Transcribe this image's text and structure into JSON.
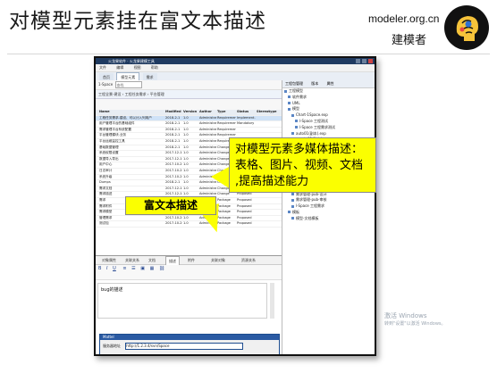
{
  "slide": {
    "title": "对模型元素挂在富文本描述",
    "site": "modeler.org.cn",
    "brand": "建模者"
  },
  "callout": {
    "lines": [
      "对模型元素多媒体描述：",
      "表格、图片、视频、文档",
      ",提高描述能力"
    ]
  },
  "label": {
    "text": "富文本描述"
  },
  "app": {
    "title_bar": "火龙果软件 · 火龙果建模工具",
    "menu": [
      "文件",
      "编辑",
      "视图",
      "帮助"
    ],
    "tabs": [
      "首页",
      "模型元素",
      "需求"
    ],
    "toolbar": {
      "package": "1-Space",
      "search_placeholder": "查找"
    },
    "path": "工程全景-建设 › 工程任务需求 › 平台管理",
    "grid_headers": [
      "Name",
      "Modified",
      "Version",
      "Author",
      "Type",
      "Status",
      "Stereotype"
    ],
    "grid_rows": [
      [
        "工程任务需求-建设、可以计入列用户",
        "2018-2-1",
        "1.0",
        "Administrat...",
        "Requirement",
        "Implement..",
        ""
      ],
      [
        "用户管理平台的基础组件",
        "2018-2-1",
        "1.0",
        "Administrat...",
        "Requirement",
        "Mandatory",
        ""
      ],
      [
        "需求管理平台系统配置",
        "2018-2-1",
        "1.0",
        "Administrat...",
        "Requirement",
        "",
        ""
      ],
      [
        "平台管理模块-业务",
        "2018-2-1",
        "1.0",
        "Administrat...",
        "Requirement",
        "",
        ""
      ],
      [
        "平台运维监控工具",
        "2018-2-1",
        "1.0",
        "Administrat...",
        "Requirement",
        "",
        ""
      ],
      [
        "基础数据管理",
        "2018-2-1",
        "1.0",
        "Administrat...",
        "Change",
        "",
        ""
      ],
      [
        "系统权限设置",
        "2017-12-16",
        "1.0",
        "Administrat...",
        "Change",
        "",
        ""
      ],
      [
        "数据导入导出",
        "2017-12-16",
        "1.0",
        "Administrat...",
        "Change",
        "",
        ""
      ],
      [
        "用户中心",
        "2017-10-26",
        "1.0",
        "Administrat...",
        "Change",
        "",
        ""
      ],
      [
        "日志审计",
        "2017-10-26",
        "1.0",
        "Administrat...",
        "Change",
        "",
        ""
      ],
      [
        "系统升级",
        "2017-10-26",
        "1.0",
        "Administrat...",
        "Change",
        "",
        ""
      ],
      [
        "Dumps",
        "2018-2-1",
        "1.0",
        "Administrat...",
        "Change",
        "Validated",
        ""
      ],
      [
        "需求文档",
        "2017-12-16",
        "1.0",
        "Administrat...",
        "Change",
        "Proposed",
        ""
      ],
      [
        "需求描述",
        "2017-12-16",
        "1.0",
        "Administrat...",
        "Change",
        "Proposed",
        ""
      ],
      [
        "需求",
        "2018-2-1",
        "1.0",
        "Administrat...",
        "Package",
        "Proposed",
        ""
      ],
      [
        "需求附件",
        "2017-10-26",
        "1.0",
        "Administrat...",
        "Package",
        "Proposed",
        ""
      ],
      [
        "需求模型",
        "2017-10-26",
        "1.0",
        "Administrat...",
        "Package",
        "Proposed",
        ""
      ],
      [
        "管理需求",
        "2017-10-26",
        "1.0",
        "Administrat...",
        "Package",
        "Proposed",
        ""
      ],
      [
        "测试包",
        "2017-10-26",
        "1.0",
        "Administrat...",
        "Package",
        "Proposed",
        ""
      ]
    ],
    "bottom_tabs": [
      "对象属性",
      "关联关系",
      "文档",
      "描述",
      "附件",
      "关联对象",
      "资源关系"
    ],
    "editor_text": "bug的描述",
    "dialog": {
      "title": "Mattel",
      "label": "服务器地址",
      "value": "http://1.2.3.4/svn/Space"
    },
    "right_tabs": [
      "工程包管理",
      "版本",
      "属性"
    ],
    "tree": [
      "工程模型",
      "软件需求",
      "UML",
      "模型",
      "Chart-1Space.exp",
      "l-Space 工程测试",
      "l-Space 工程需求测试",
      "auto01(副本).exp",
      "auto02(副本).exp",
      "l-Space 工程测试",
      "(alan)(副本).exp",
      "工程需求",
      "l-Space 工程模型",
      "需求文档-pub-Space",
      "l-Space 工程需求",
      "工程包管理",
      "需求管理-pub-规划",
      "需求管理-pub-设计",
      "需求管理-pub-审核",
      "l-Space 工程需求",
      "模板",
      "模型-文档模板"
    ],
    "watermark": [
      "激活 Windows",
      "转到\"设置\"以激活 Windows。"
    ]
  }
}
